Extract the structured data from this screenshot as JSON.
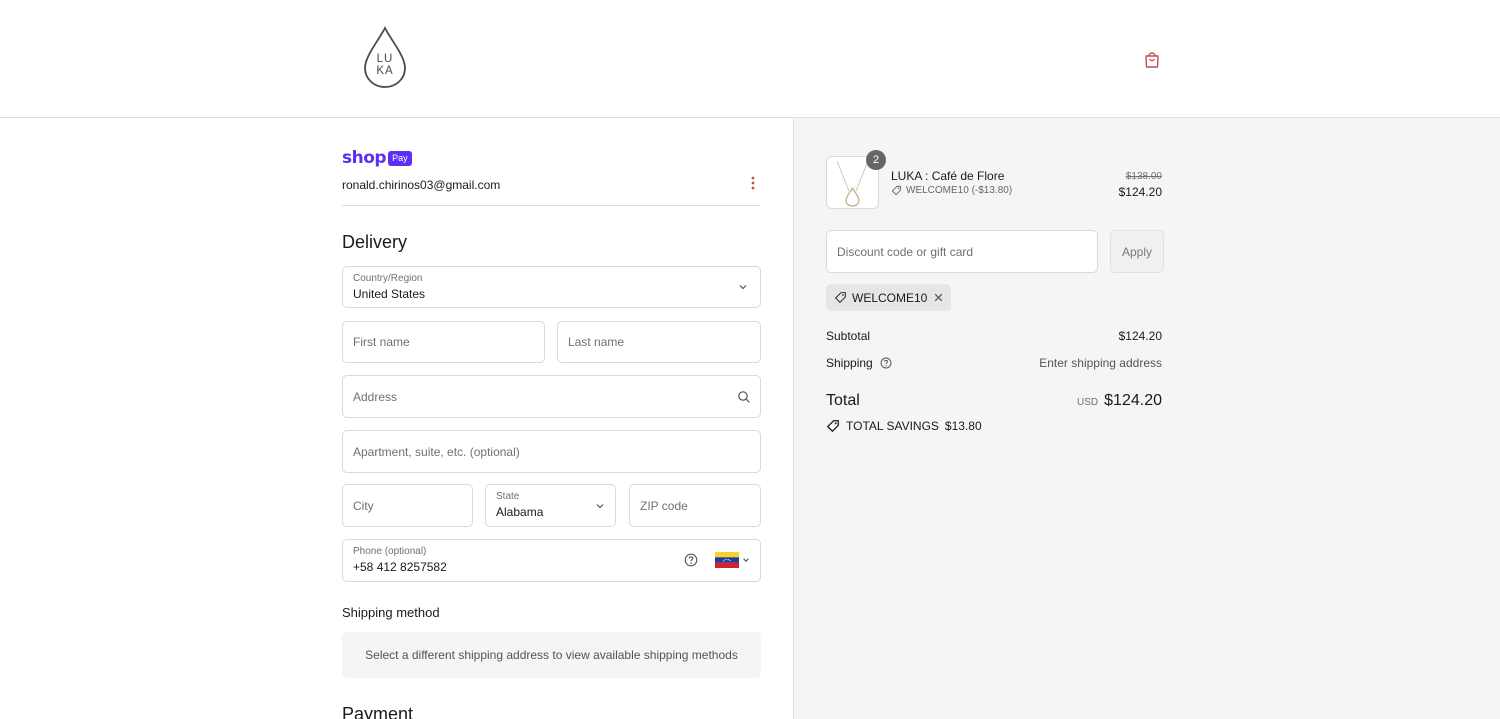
{
  "brand": {
    "logo_line1": "LU",
    "logo_line2": "KA",
    "accent": "#c44d4d",
    "shop_pay_color": "#5a31f4"
  },
  "account": {
    "shop_word": "shop",
    "pay_badge": "Pay",
    "email": "ronald.chirinos03@gmail.com"
  },
  "delivery": {
    "title": "Delivery",
    "country_label": "Country/Region",
    "country_value": "United States",
    "first_name_placeholder": "First name",
    "last_name_placeholder": "Last name",
    "address_placeholder": "Address",
    "apartment_placeholder": "Apartment, suite, etc. (optional)",
    "city_placeholder": "City",
    "state_label": "State",
    "state_value": "Alabama",
    "zip_placeholder": "ZIP code",
    "phone_label": "Phone (optional)",
    "phone_value": "+58 412 8257582",
    "phone_flag": "venezuela-flag"
  },
  "shipping": {
    "title": "Shipping method",
    "notice": "Select a different shipping address to view available shipping methods"
  },
  "payment": {
    "title": "Payment"
  },
  "order": {
    "item": {
      "name": "LUKA : Café de Flore",
      "quantity": "2",
      "discount": "WELCOME10 (-$13.80)",
      "original_price": "$138.00",
      "price": "$124.20"
    },
    "discount_placeholder": "Discount code or gift card",
    "apply_label": "Apply",
    "applied_code": "WELCOME10",
    "subtotal_label": "Subtotal",
    "subtotal_value": "$124.20",
    "shipping_label": "Shipping",
    "shipping_value": "Enter shipping address",
    "total_label": "Total",
    "currency": "USD",
    "total_value": "$124.20",
    "savings_label": "TOTAL SAVINGS",
    "savings_value": "$13.80"
  }
}
